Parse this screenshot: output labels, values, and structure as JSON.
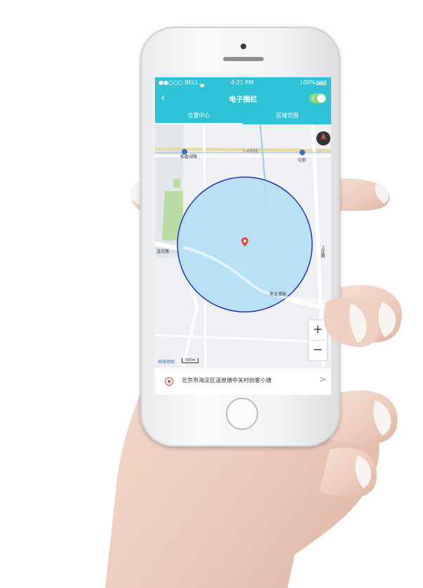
{
  "status_bar": {
    "carrier": "●●○○○ BELL",
    "time": "4:21 PM",
    "battery": "100%"
  },
  "header": {
    "title": "电子围栏",
    "back_icon": "chevron-left-icon",
    "toggle_on": true
  },
  "tabs": [
    {
      "label": "位置中心",
      "active": true
    },
    {
      "label": "区域范围",
      "active": false
    }
  ],
  "map": {
    "road_labels": [
      "稻香湖路",
      "1-6号线",
      "屯佃",
      "温北路",
      "黑龙潭路",
      "上庄路"
    ],
    "attribution": "高德地图",
    "scale": "500m",
    "zoom_in": "+",
    "zoom_out": "−",
    "fence_color": "#b3e0f5",
    "fence_border": "#2433b8"
  },
  "address": {
    "text": "北京市海淀区温泉镇中关村创客小镇",
    "chevron": ">"
  }
}
